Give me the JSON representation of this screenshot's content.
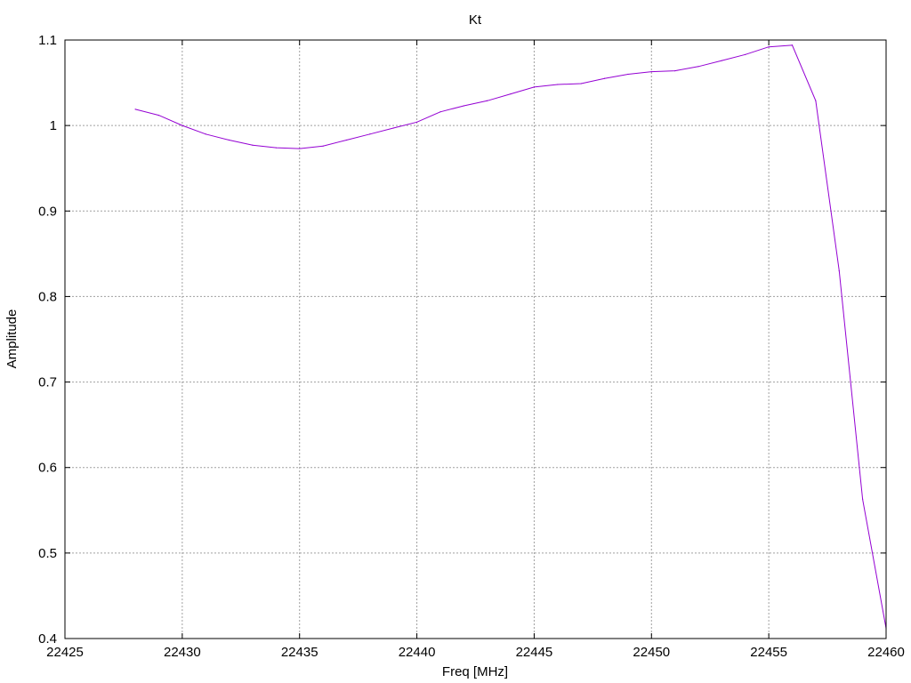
{
  "chart_data": {
    "type": "line",
    "title": "Kt",
    "xlabel": "Freq [MHz]",
    "ylabel": "Amplitude",
    "xlim": [
      22425,
      22460
    ],
    "ylim": [
      0.4,
      1.1
    ],
    "xticks": [
      22425,
      22430,
      22435,
      22440,
      22445,
      22450,
      22455,
      22460
    ],
    "xtick_labels": [
      "22425",
      "22430",
      "22435",
      "22440",
      "22445",
      "22450",
      "22455",
      "22460"
    ],
    "yticks": [
      0.4,
      0.5,
      0.6,
      0.7,
      0.8,
      0.9,
      1.0,
      1.1
    ],
    "ytick_labels": [
      "0.4",
      "0.5",
      "0.6",
      "0.7",
      "0.8",
      "0.9",
      "1",
      "1.1"
    ],
    "grid": true,
    "legend": "none",
    "series": [
      {
        "color": "#9400d3",
        "x": [
          22428,
          22429,
          22430,
          22431,
          22432,
          22433,
          22434,
          22435,
          22436,
          22437,
          22438,
          22439,
          22440,
          22441,
          22442,
          22443,
          22444,
          22445,
          22446,
          22447,
          22448,
          22449,
          22450,
          22451,
          22452,
          22453,
          22454,
          22455,
          22456,
          22457,
          22458,
          22459,
          22460
        ],
        "y": [
          1.019,
          1.012,
          1.0,
          0.99,
          0.983,
          0.977,
          0.974,
          0.973,
          0.976,
          0.983,
          0.99,
          0.997,
          1.004,
          1.016,
          1.023,
          1.029,
          1.037,
          1.045,
          1.048,
          1.049,
          1.055,
          1.06,
          1.063,
          1.064,
          1.069,
          1.076,
          1.083,
          1.092,
          1.094,
          1.029,
          0.83,
          0.563,
          0.412
        ]
      }
    ]
  }
}
